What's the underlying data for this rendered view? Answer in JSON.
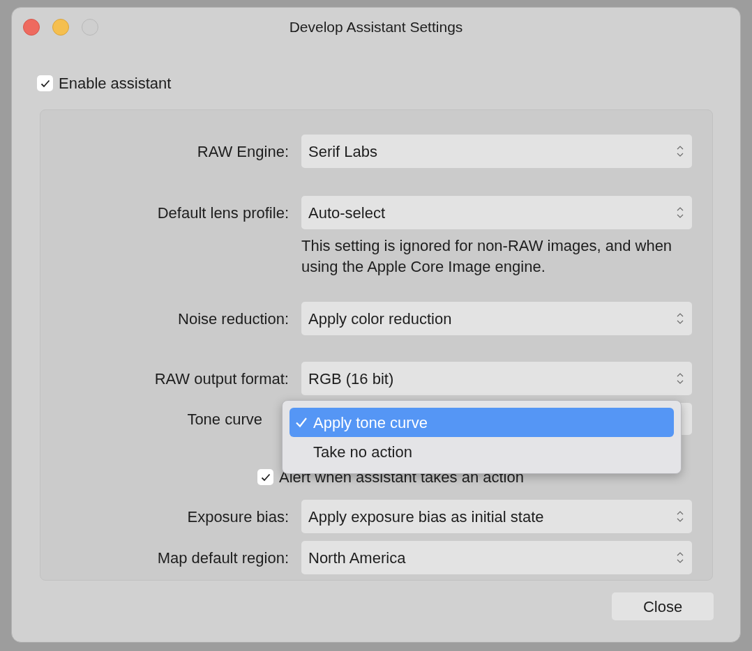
{
  "window": {
    "title": "Develop Assistant Settings"
  },
  "enable_assistant": {
    "label": "Enable assistant",
    "checked": true
  },
  "rows": [
    {
      "kind": "select",
      "label": "RAW Engine:",
      "value": "Serif Labs"
    },
    {
      "kind": "select",
      "label": "Default lens profile:",
      "value": "Auto-select"
    },
    {
      "kind": "note",
      "text": "This setting is ignored for non-RAW images, and when using the Apple Core Image engine."
    },
    {
      "kind": "select",
      "label": "Noise reduction:",
      "value": "Apply color reduction"
    },
    {
      "kind": "select",
      "label": "RAW output format:",
      "value": "RGB (16 bit)"
    },
    {
      "kind": "popup",
      "label": "Tone curve",
      "options": [
        {
          "label": "Apply tone curve",
          "selected": true
        },
        {
          "label": "Take no action",
          "selected": false
        }
      ]
    },
    {
      "kind": "checkbox",
      "label": "Alert when assistant takes an action",
      "checked": true
    },
    {
      "kind": "select",
      "label": "Exposure bias:",
      "value": "Apply exposure bias as initial state"
    },
    {
      "kind": "select",
      "label": "Map default region:",
      "value": "North America"
    }
  ],
  "buttons": [
    {
      "label": "Close"
    }
  ]
}
